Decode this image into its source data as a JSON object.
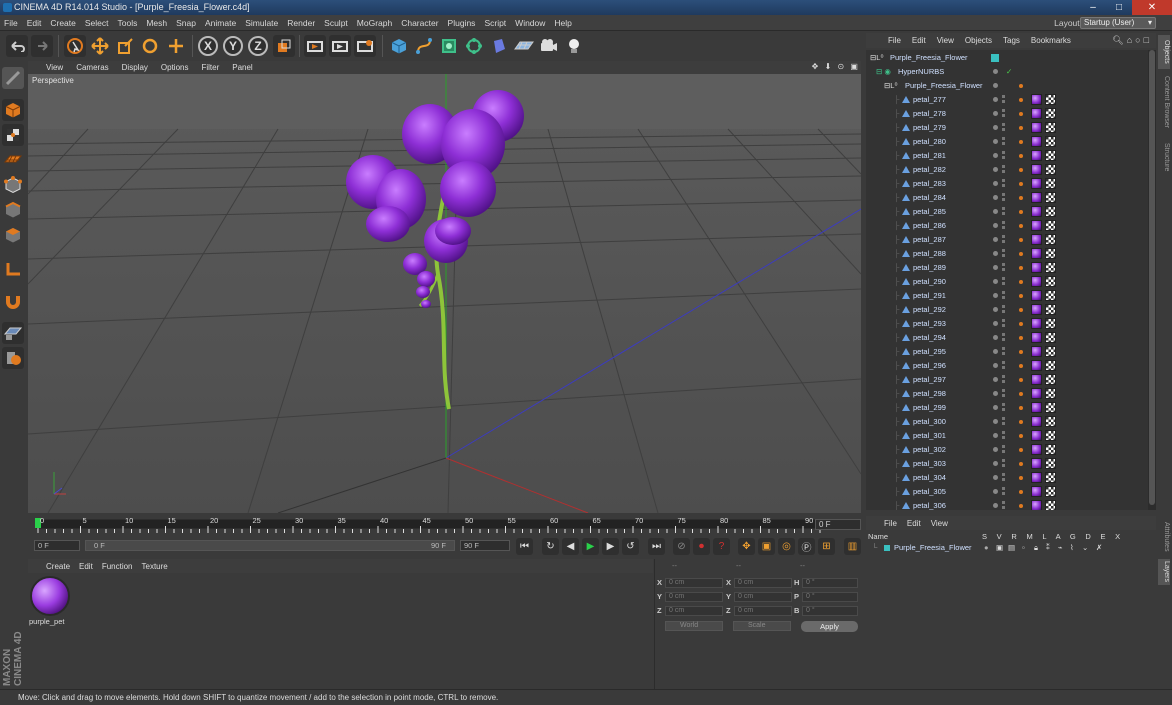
{
  "window": {
    "title": "CINEMA 4D R14.014 Studio - [Purple_Freesia_Flower.c4d]"
  },
  "menubar": {
    "items": [
      "File",
      "Edit",
      "Create",
      "Select",
      "Tools",
      "Mesh",
      "Snap",
      "Animate",
      "Simulate",
      "Render",
      "Sculpt",
      "MoGraph",
      "Character",
      "Plugins",
      "Script",
      "Window",
      "Help"
    ]
  },
  "layout": {
    "label": "Layout:",
    "value": "Startup (User)"
  },
  "toolbar": {
    "x_label": "X",
    "y_label": "Y",
    "z_label": "Z"
  },
  "viewport": {
    "menu": [
      "View",
      "Cameras",
      "Display",
      "Options",
      "Filter",
      "Panel"
    ],
    "label": "Perspective",
    "nav_icons": "✥ ⬇ ⊙ ▣"
  },
  "timeline": {
    "ticks": [
      "0",
      "5",
      "10",
      "15",
      "20",
      "25",
      "30",
      "35",
      "40",
      "45",
      "50",
      "55",
      "60",
      "65",
      "70",
      "75",
      "80",
      "85",
      "90"
    ],
    "current_frame": "0 F"
  },
  "playbar": {
    "start_field": "0 F",
    "range_start": "0 F",
    "range_end": "90 F",
    "end_field": "90 F"
  },
  "material_manager": {
    "menu": [
      "Create",
      "Edit",
      "Function",
      "Texture"
    ],
    "material_name": "purple_pet"
  },
  "coordinates": {
    "header_dashes": [
      "--",
      "--",
      "--"
    ],
    "rows": [
      {
        "axis1": "X",
        "v1": "0 cm",
        "axis2": "X",
        "v2": "0 cm",
        "axis3": "H",
        "v3": "0 °"
      },
      {
        "axis1": "Y",
        "v1": "0 cm",
        "axis2": "Y",
        "v2": "0 cm",
        "axis3": "P",
        "v3": "0 °"
      },
      {
        "axis1": "Z",
        "v1": "0 cm",
        "axis2": "Z",
        "v2": "0 cm",
        "axis3": "B",
        "v3": "0 °"
      }
    ],
    "mode": "World",
    "scale_mode": "Scale",
    "apply": "Apply"
  },
  "object_manager": {
    "menu": [
      "File",
      "Edit",
      "View",
      "Objects",
      "Tags",
      "Bookmarks"
    ],
    "root": "Purple_Freesia_Flower",
    "hypernurbs": "HyperNURBS",
    "child": "Purple_Freesia_Flower",
    "petals": [
      "petal_277",
      "petal_278",
      "petal_279",
      "petal_280",
      "petal_281",
      "petal_282",
      "petal_283",
      "petal_284",
      "petal_285",
      "petal_286",
      "petal_287",
      "petal_288",
      "petal_289",
      "petal_290",
      "petal_291",
      "petal_292",
      "petal_293",
      "petal_294",
      "petal_295",
      "petal_296",
      "petal_297",
      "petal_298",
      "petal_299",
      "petal_300",
      "petal_301",
      "petal_302",
      "petal_303",
      "petal_304",
      "petal_305",
      "petal_306"
    ]
  },
  "layer_manager": {
    "menu": [
      "File",
      "Edit",
      "View"
    ],
    "name_header": "Name",
    "columns": "S V R M L A G D E X",
    "layer_name": "Purple_Freesia_Flower"
  },
  "side_tabs": [
    "Objects",
    "Content Browser",
    "Structure",
    "Attributes",
    "Layers"
  ],
  "status": "Move: Click and drag to move elements. Hold down SHIFT to quantize movement / add to the selection in point mode, CTRL to remove.",
  "brand": "MAXON CINEMA 4D"
}
